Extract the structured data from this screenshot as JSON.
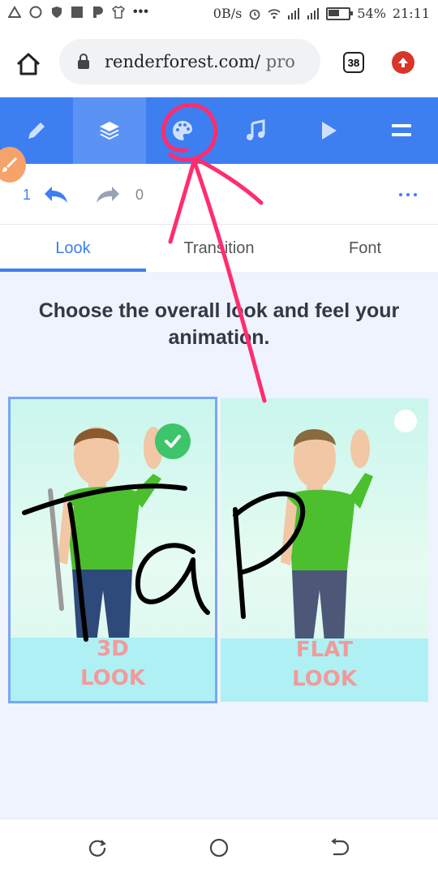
{
  "status_bar": {
    "net_speed": "0B/s",
    "battery": "54%",
    "time": "21:11"
  },
  "browser": {
    "url_main": "renderforest.com/",
    "url_path": " pro",
    "tab_count": "38"
  },
  "toolbar": {
    "items": [
      {
        "icon": "pencil-icon"
      },
      {
        "icon": "layers-icon",
        "active": true
      },
      {
        "icon": "palette-icon"
      },
      {
        "icon": "music-icon"
      },
      {
        "icon": "play-icon"
      },
      {
        "icon": "menu-icon"
      }
    ]
  },
  "history": {
    "undo_count": "1",
    "redo_count": "0"
  },
  "subtabs": [
    {
      "label": "Look",
      "active": true
    },
    {
      "label": "Transition"
    },
    {
      "label": "Font"
    }
  ],
  "main": {
    "heading": "Choose the overall look and feel your animation."
  },
  "cards": [
    {
      "label_line1": "3D",
      "label_line2": "LOOK",
      "selected": true
    },
    {
      "label_line1": "FLAT",
      "label_line2": "LOOK",
      "selected": false
    }
  ],
  "annotation": {
    "text": "Tap",
    "color": "#ff2d6e"
  },
  "colors": {
    "accent": "#3d7ff0",
    "check": "#3ec46a",
    "label": "#f29a9a"
  }
}
